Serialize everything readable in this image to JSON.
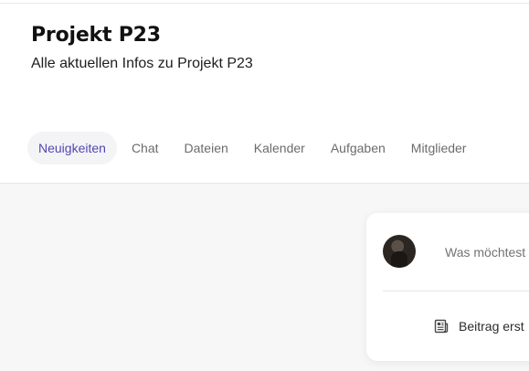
{
  "project": {
    "title": "Projekt P23",
    "subtitle": "Alle aktuellen Infos zu Projekt P23"
  },
  "tabs": [
    {
      "label": "Neuigkeiten",
      "active": true
    },
    {
      "label": "Chat",
      "active": false
    },
    {
      "label": "Dateien",
      "active": false
    },
    {
      "label": "Kalender",
      "active": false
    },
    {
      "label": "Aufgaben",
      "active": false
    },
    {
      "label": "Mitglieder",
      "active": false
    }
  ],
  "composer": {
    "placeholder": "Was möchtest",
    "action_label": "Beitrag erst",
    "action_icon": "newspaper-icon"
  },
  "colors": {
    "accent": "#5247b3",
    "active_tab_bg": "#f4f4f6",
    "content_bg": "#f7f7f7"
  }
}
